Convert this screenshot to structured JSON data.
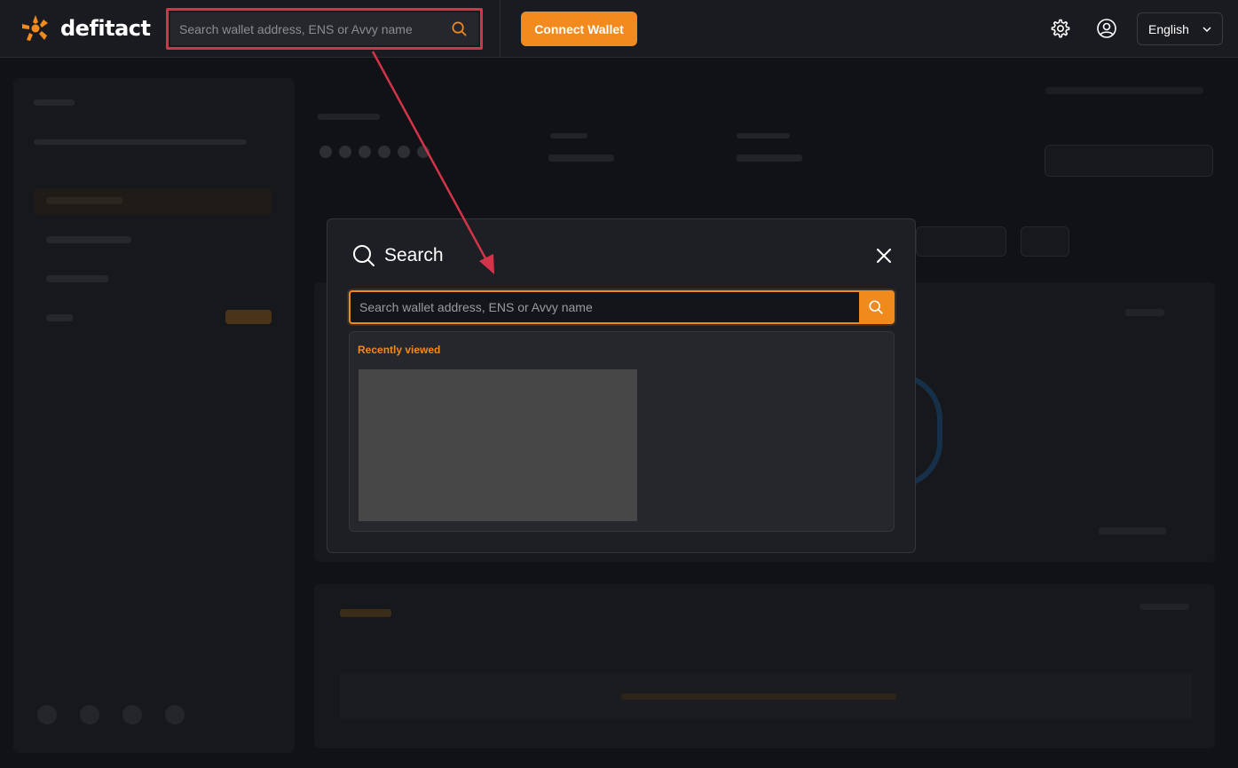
{
  "header": {
    "logo_text": "defitact",
    "search_placeholder": "Search wallet address, ENS or Avvy name",
    "connect_label": "Connect Wallet",
    "language": "English",
    "icons": [
      "search-icon",
      "gear-icon",
      "user-circle-icon",
      "chevron-down-icon"
    ]
  },
  "modal": {
    "title": "Search",
    "search_placeholder": "Search wallet address, ENS or Avvy name",
    "recent_label": "Recently viewed",
    "icons": [
      "search-icon",
      "close-icon"
    ]
  },
  "colors": {
    "accent": "#f38a1d",
    "highlight": "#d4344a",
    "background": "#111216",
    "surface": "#1e1f24"
  }
}
